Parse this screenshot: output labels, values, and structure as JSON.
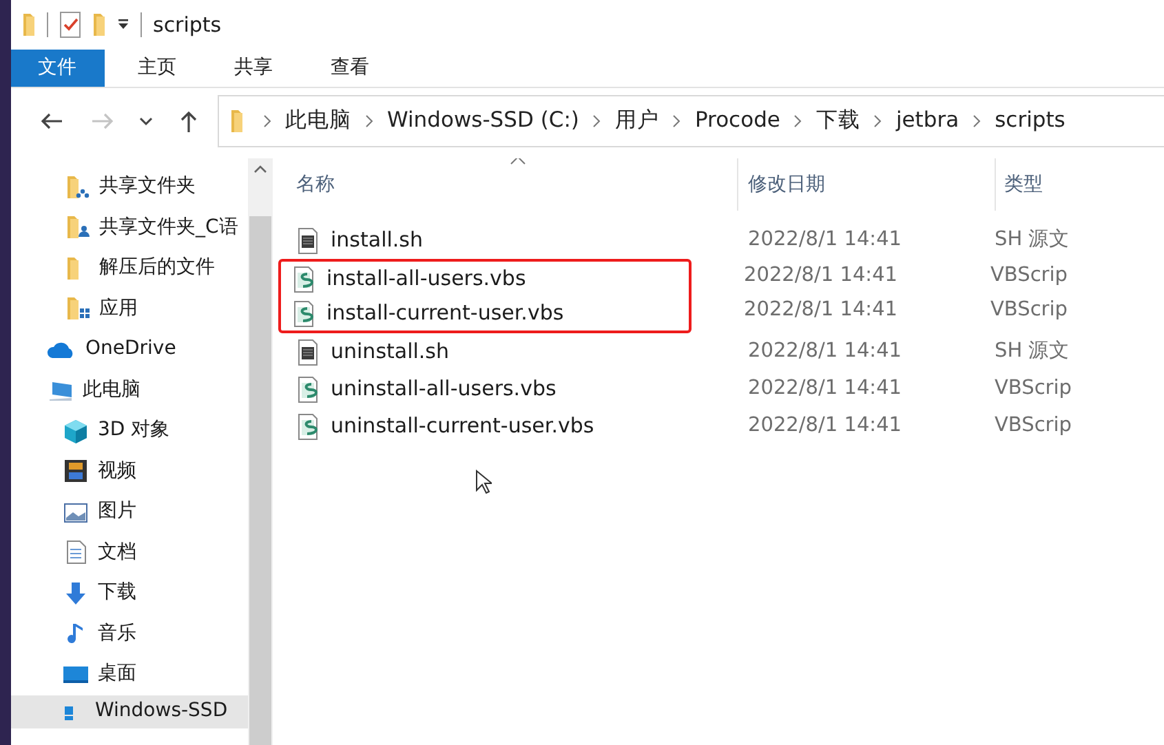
{
  "window": {
    "title": "scripts"
  },
  "ribbon_tabs": [
    {
      "label": "文件",
      "selected": true
    },
    {
      "label": "主页",
      "selected": false
    },
    {
      "label": "共享",
      "selected": false
    },
    {
      "label": "查看",
      "selected": false
    }
  ],
  "nav_buttons": [
    {
      "kind": "back",
      "disabled": false
    },
    {
      "kind": "forward",
      "disabled": true
    },
    {
      "kind": "recent",
      "disabled": false
    },
    {
      "kind": "up",
      "disabled": false
    }
  ],
  "breadcrumb": [
    "此电脑",
    "Windows-SSD (C:)",
    "用户",
    "Procode",
    "下载",
    "jetbra",
    "scripts"
  ],
  "sidebar": {
    "items": [
      {
        "label": "共享文件夹",
        "kind": "shared-folder",
        "selected": false
      },
      {
        "label": "共享文件夹_C语",
        "kind": "user-folder",
        "selected": false
      },
      {
        "label": "解压后的文件",
        "kind": "folder",
        "selected": false
      },
      {
        "label": "应用",
        "kind": "apps-folder",
        "selected": false
      },
      {
        "label": "OneDrive",
        "kind": "cloud",
        "selected": false
      },
      {
        "label": "此电脑",
        "kind": "computer",
        "selected": false,
        "children": [
          {
            "label": "3D 对象",
            "kind": "cube",
            "selected": false
          },
          {
            "label": "视频",
            "kind": "film",
            "selected": false
          },
          {
            "label": "图片",
            "kind": "picture",
            "selected": false
          },
          {
            "label": "文档",
            "kind": "document",
            "selected": false
          },
          {
            "label": "下载",
            "kind": "download",
            "selected": false
          },
          {
            "label": "音乐",
            "kind": "music",
            "selected": false
          },
          {
            "label": "桌面",
            "kind": "desktop",
            "selected": false
          },
          {
            "label": "Windows-SSD",
            "kind": "drive",
            "selected": true
          }
        ]
      }
    ]
  },
  "table": {
    "columns": [
      "名称",
      "修改日期",
      "类型"
    ],
    "rows": [
      {
        "name": "install.sh",
        "kind": "sh",
        "date": "2022/8/1 14:41",
        "type": "SH 源文",
        "boxed": false
      },
      {
        "name": "install-all-users.vbs",
        "kind": "vbs",
        "date": "2022/8/1 14:41",
        "type": "VBScrip",
        "boxed": true
      },
      {
        "name": "install-current-user.vbs",
        "kind": "vbs",
        "date": "2022/8/1 14:41",
        "type": "VBScrip",
        "boxed": true
      },
      {
        "name": "uninstall.sh",
        "kind": "sh",
        "date": "2022/8/1 14:41",
        "type": "SH 源文",
        "boxed": false
      },
      {
        "name": "uninstall-all-users.vbs",
        "kind": "vbs",
        "date": "2022/8/1 14:41",
        "type": "VBScrip",
        "boxed": false
      },
      {
        "name": "uninstall-current-user.vbs",
        "kind": "vbs",
        "date": "2022/8/1 14:41",
        "type": "VBScrip",
        "boxed": false
      }
    ]
  }
}
